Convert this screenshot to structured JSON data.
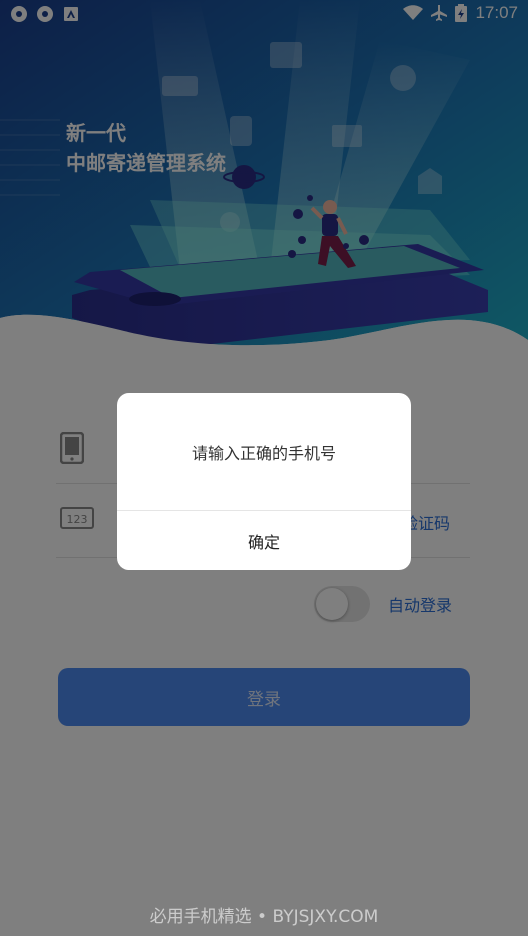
{
  "status_bar": {
    "time": "17:07",
    "left_icons": [
      "vpn-icon",
      "vpn-icon",
      "font-icon"
    ],
    "right_icons": [
      "wifi-icon",
      "airplane-icon",
      "battery-icon"
    ]
  },
  "hero": {
    "title_line1": "新一代",
    "title_line2": "中邮寄递管理系统"
  },
  "form": {
    "phone_placeholder": "",
    "code_placeholder": "",
    "get_code_label": "获取验证码",
    "auto_login_label": "自动登录",
    "auto_login_enabled": false,
    "login_button_label": "登录"
  },
  "dialog": {
    "message": "请输入正确的手机号",
    "confirm_label": "确定"
  },
  "watermark": "必用手机精选 • BYJSJXY.COM",
  "colors": {
    "accent": "#2c6fd6",
    "button": "#4d8af0",
    "hero_dark": "#1b3a8c",
    "hero_light": "#1aa3c4"
  }
}
